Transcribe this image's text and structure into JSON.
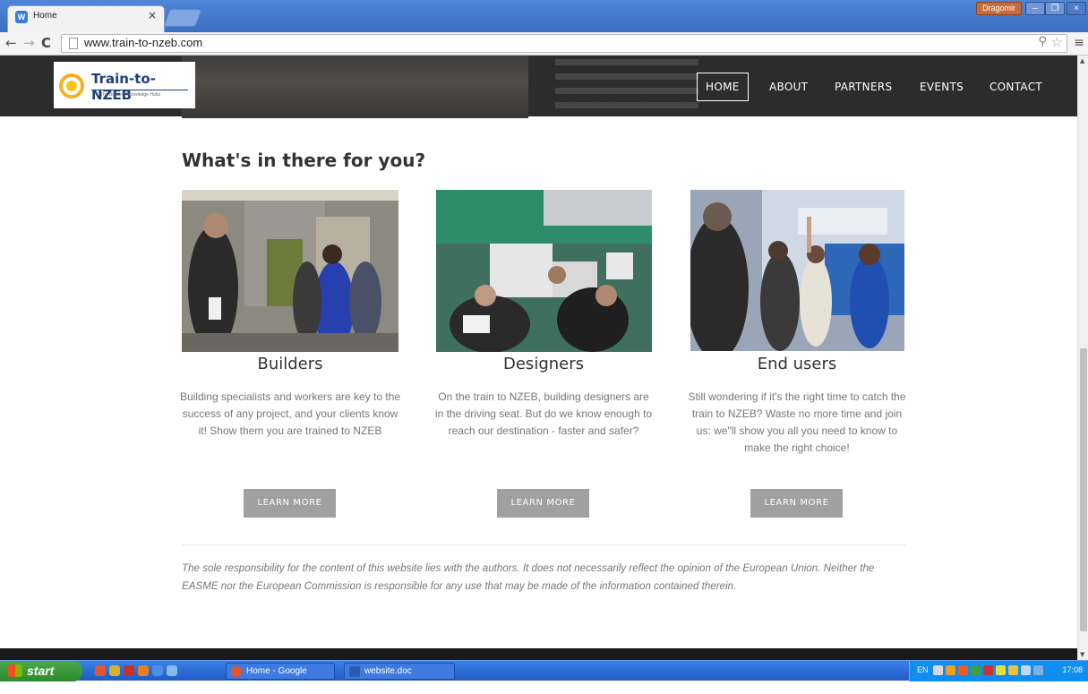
{
  "browser": {
    "tab_title": "Home",
    "url": "www.train-to-nzeb.com",
    "user_name": "Dragomir"
  },
  "site": {
    "logo_title": "Train-to-NZEB",
    "logo_subtitle": "The Building Knowledge Hubs",
    "nav": [
      "HOME",
      "ABOUT",
      "PARTNERS",
      "EVENTS",
      "CONTACT"
    ],
    "section_title": "What's in there for you?",
    "cards": [
      {
        "heading": "Builders",
        "text": "Building specialists and workers are key to the success of any project, and your clients know it! Show them you are trained to NZEB",
        "button": "LEARN MORE"
      },
      {
        "heading": "Designers",
        "text": "On the train to NZEB, building designers are in the driving seat. But do we know enough to reach our destination - faster and safer?",
        "button": "LEARN MORE"
      },
      {
        "heading": "End users",
        "text": "Still wondering if it's the right time to catch the train to NZEB? Waste no more time and join us: we\"ll show you all you need to know to make the right choice!",
        "button": "LEARN MORE"
      }
    ],
    "disclaimer": "The sole responsibility for the content of this website lies with the authors. It does not necessarily reflect the opinion of the European Union. Neither the EASME nor the European Commission is responsible for any use that may be made of the information contained therein."
  },
  "taskbar": {
    "start_label": "start",
    "items": [
      "Home - Google Chrome",
      "website.doc [Compati..."
    ],
    "tray_lang": "EN",
    "clock": "17:08"
  },
  "colors": {
    "header_bg": "#2c2c2c",
    "button_bg": "#a0a0a0",
    "logo_blue": "#1e3f78",
    "logo_yellow": "#f4b21e"
  }
}
